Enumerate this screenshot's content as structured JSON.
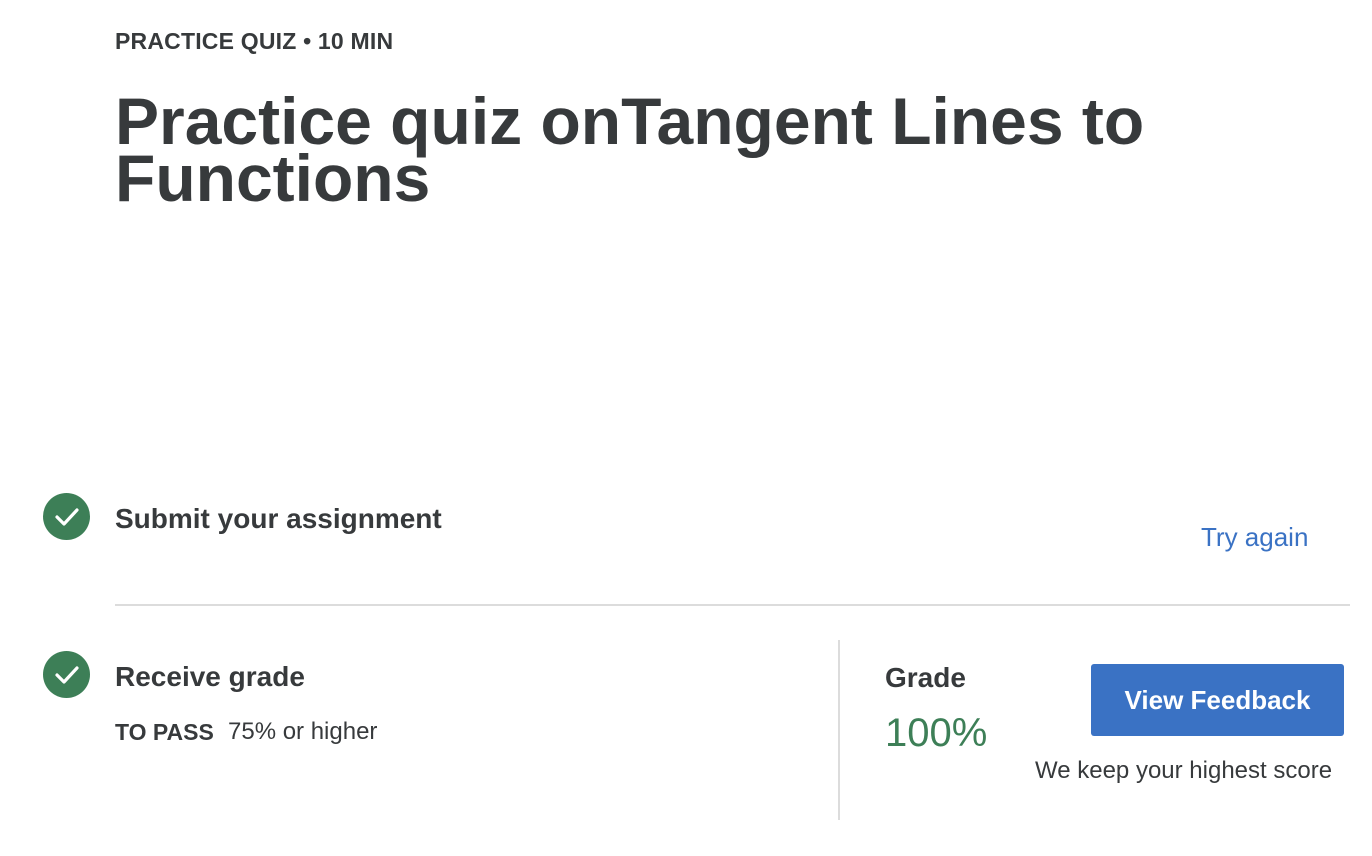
{
  "header": {
    "meta": "PRACTICE QUIZ • 10 MIN",
    "title": "Practice quiz onTangent Lines to Functions"
  },
  "steps": {
    "submit": {
      "title": "Submit your assignment",
      "action": "Try again",
      "icon": "check-circle-icon"
    },
    "grade": {
      "title": "Receive grade",
      "pass_label": "TO PASS",
      "pass_value": "75% or higher",
      "icon": "check-circle-icon"
    }
  },
  "result": {
    "grade_label": "Grade",
    "grade_value": "100%",
    "feedback_button": "View Feedback",
    "note": "We keep your highest score"
  },
  "colors": {
    "success": "#3d7f57",
    "accent": "#3a72c4",
    "text": "#373a3c"
  }
}
